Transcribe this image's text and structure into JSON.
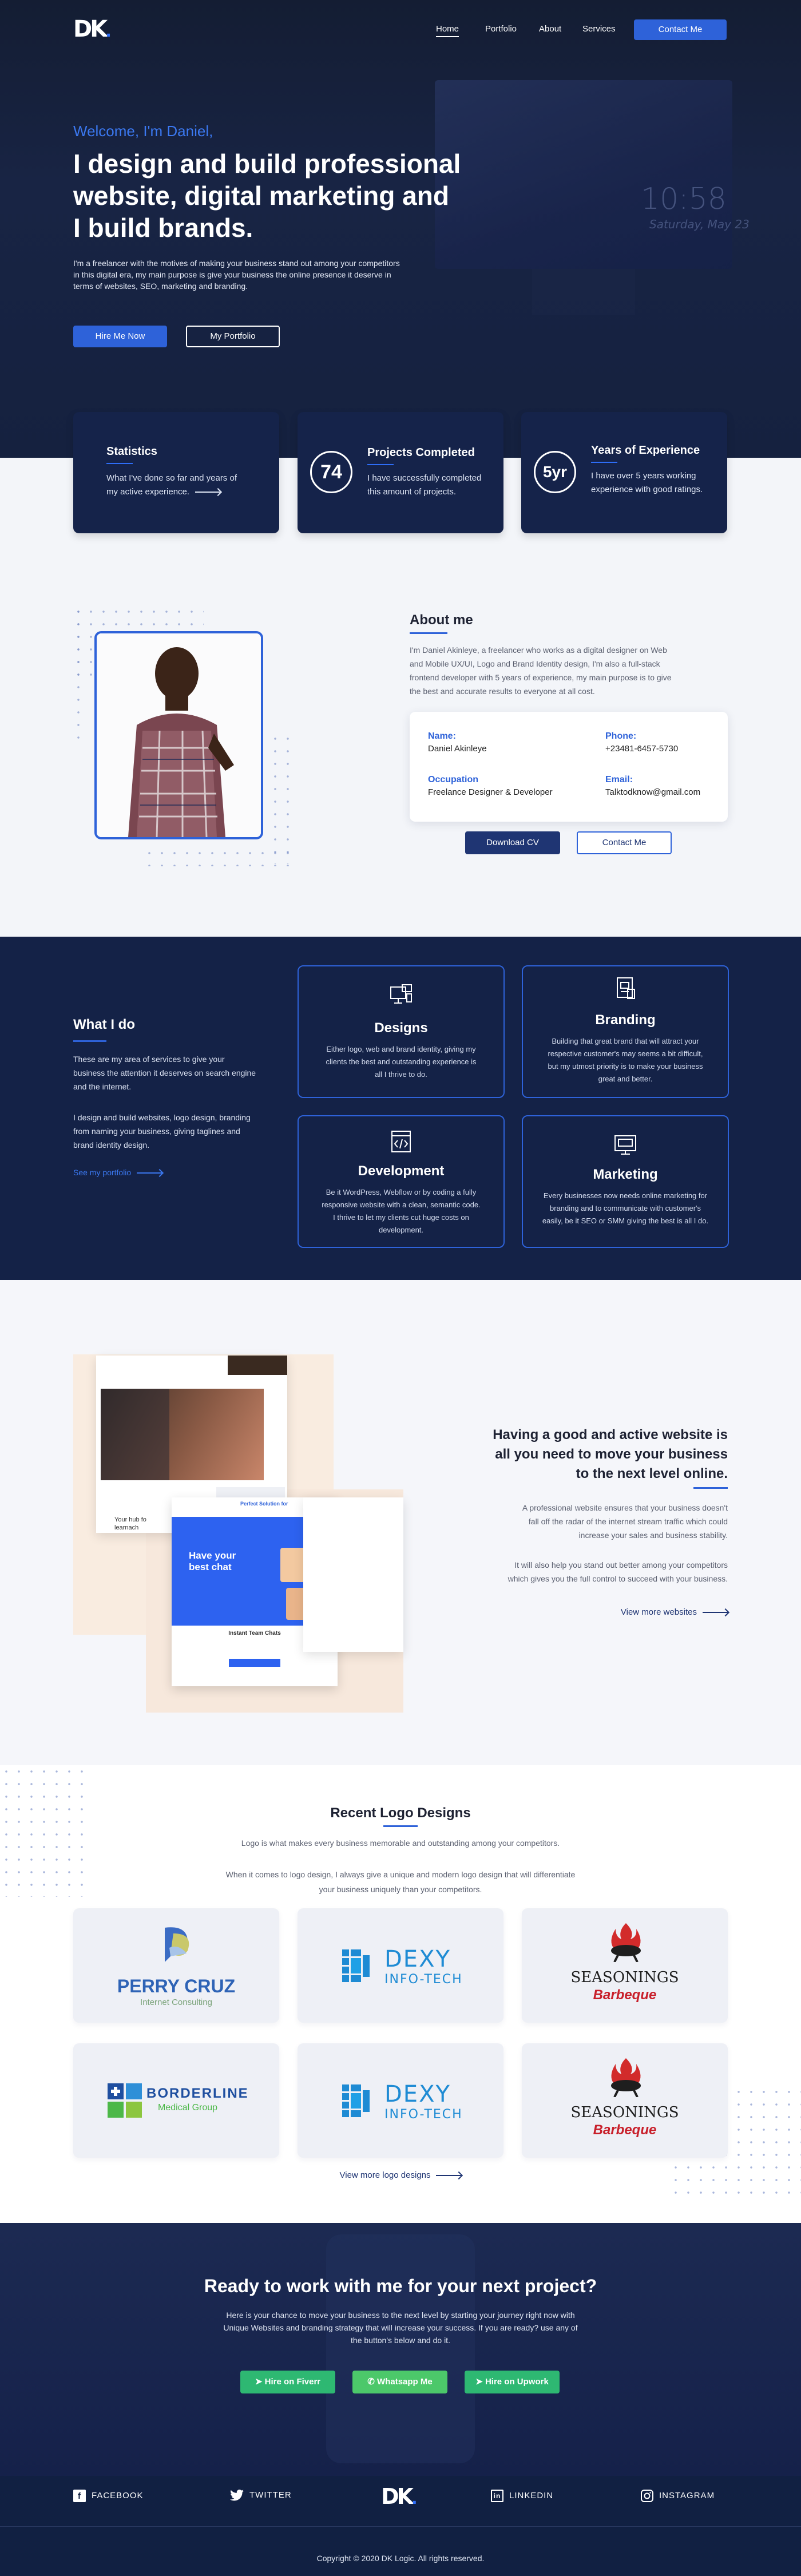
{
  "nav": {
    "logo": "DK",
    "links": [
      "Home",
      "Portfolio",
      "About",
      "Services"
    ],
    "contact_button": "Contact Me"
  },
  "hero": {
    "welcome": "Welcome, I'm Daniel,",
    "headline_lines": [
      "I design and build professional",
      "website, digital marketing and",
      "I build brands."
    ],
    "intro_lines": [
      "I'm a freelancer with the motives of making your business stand out among your competitors",
      "in this digital era, my main purpose is give your business the online presence it deserve in",
      "terms of websites, SEO, marketing and branding."
    ],
    "hire_button": "Hire Me Now",
    "portfolio_button": "My Portfolio",
    "clock_time": "10:58",
    "clock_date": "Saturday, May 23"
  },
  "stats": [
    {
      "title": "Statistics",
      "desc_lines": [
        "What I've done so far and years of",
        "my active experience."
      ]
    },
    {
      "badge": "74",
      "title": "Projects Completed",
      "desc_lines": [
        "I have successfully completed",
        "this amount of projects."
      ]
    },
    {
      "badge": "5yr",
      "title": "Years of Experience",
      "desc_lines": [
        "I have over 5 years working",
        "experience with good ratings."
      ]
    }
  ],
  "about": {
    "title": "About me",
    "text_lines": [
      "I'm Daniel Akinleye, a freelancer who works as a digital designer on Web",
      "and Mobile UX/UI, Logo and Brand Identity design, I'm also a full-stack",
      "frontend developer with 5 years of experience, my main purpose is to give",
      "the best and accurate results to everyone at all cost."
    ],
    "name_label": "Name:",
    "name_value": "Daniel Akinleye",
    "phone_label": "Phone:",
    "phone_value": "+23481-6457-5730",
    "occupation_label": "Occupation",
    "occupation_value": "Freelance Designer & Developer",
    "email_label": "Email:",
    "email_value": "Talktodknow@gmail.com",
    "download_button": "Download CV",
    "contact_button": "Contact Me"
  },
  "services": {
    "title": "What I do",
    "text1_lines": [
      "These are my area of services to give your",
      "business the attention it deserves on search engine",
      "and the internet."
    ],
    "text2_lines": [
      "I design and build websites, logo design, branding",
      "from naming your business, giving taglines and",
      "brand identity design."
    ],
    "link": "See my portfolio",
    "cards": [
      {
        "title": "Designs",
        "icon": "design-icon",
        "desc_lines": [
          "Either logo, web and brand identity, giving my",
          "clients the best and outstanding experience is",
          "all I thrive to do."
        ]
      },
      {
        "title": "Branding",
        "icon": "branding-icon",
        "desc_lines": [
          "Building that great brand that will attract your",
          "respective customer's may seems a bit difficult,",
          "but my utmost priority is to make your business",
          "great and better."
        ]
      },
      {
        "title": "Development",
        "icon": "code-icon",
        "desc_lines": [
          "Be it WordPress, Webflow or by coding a fully",
          "responsive website with a clean, semantic code.",
          "I thrive to let my clients cut huge costs on",
          "development."
        ]
      },
      {
        "title": "Marketing",
        "icon": "seo-icon",
        "desc_lines": [
          "Every businesses now needs online marketing for",
          "branding and to communicate with customer's",
          "easily, be it SEO or SMM giving the best is all I do."
        ]
      }
    ]
  },
  "website": {
    "headline_lines": [
      "Having a good and active website is",
      "all you need to move your business",
      "to the next level online."
    ],
    "text1_lines": [
      "A professional website ensures that your business doesn't",
      "fall off the radar of the internet stream traffic which could",
      "increase your sales and business stability."
    ],
    "text2_lines": [
      "It will also help you stand out better among your competitors",
      "which gives you the full control to succeed with your business."
    ],
    "link": "View more websites",
    "mock1_text": "Your hub fo learnach",
    "mock2_title_lines": [
      "Have your",
      "best chat"
    ],
    "mock2_side": "Perfect Solution for",
    "mock2_footer": "Instant Team Chats"
  },
  "logos": {
    "title": "Recent Logo Designs",
    "text1": "Logo is what makes every business memorable and outstanding among your competitors.",
    "text2_lines": [
      "When it comes to logo design, I always give a unique and modern logo design that will differentiate",
      "your business uniquely than your competitors."
    ],
    "items": [
      {
        "name": "PERRY CRUZ",
        "sub": "Internet Consulting"
      },
      {
        "name": "DEXY",
        "sub": "INFO-TECH"
      },
      {
        "name": "SEASONINGS",
        "sub": "Barbeque"
      },
      {
        "name": "BORDERLINE",
        "sub": "Medical Group"
      },
      {
        "name": "DEXY",
        "sub": "INFO-TECH"
      },
      {
        "name": "SEASONINGS",
        "sub": "Barbeque"
      }
    ],
    "link": "View more logo designs"
  },
  "cta": {
    "title": "Ready to work with me for your next project?",
    "text_lines": [
      "Here is your chance to move your business to the next level by starting your journey right now with",
      "Unique Websites and branding strategy that will increase your success. If you are ready? use any of",
      "the button's below and do it."
    ],
    "buttons": [
      "Hire on Fiverr",
      "Whatsapp Me",
      "Hire on Upwork"
    ]
  },
  "footer": {
    "socials": [
      "FACEBOOK",
      "TWITTER",
      "LINKEDIN",
      "INSTAGRAM"
    ],
    "copyright": "Copyright © 2020 DK Logic. All rights reserved."
  },
  "colors": {
    "primary": "#2e62d9",
    "navy": "#142247",
    "green": "#2eb872"
  }
}
